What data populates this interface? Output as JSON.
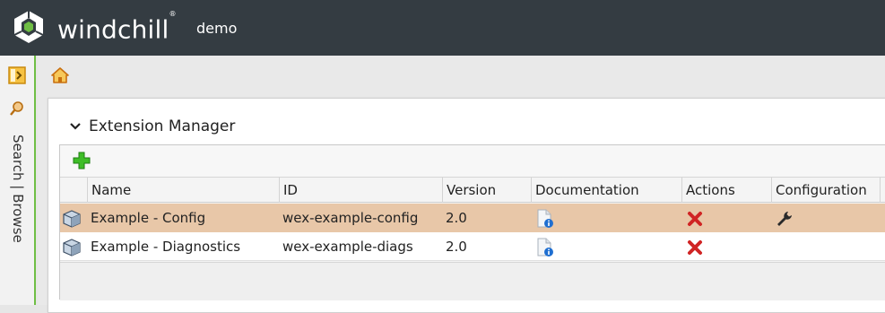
{
  "header": {
    "brand": "windchill",
    "trademark": "®",
    "context": "demo"
  },
  "sidebar": {
    "vertical_label": "Search | Browse"
  },
  "panel": {
    "title": "Extension Manager"
  },
  "table": {
    "columns": [
      "Name",
      "ID",
      "Version",
      "Documentation",
      "Actions",
      "Configuration"
    ],
    "rows": [
      {
        "name": "Example - Config",
        "id": "wex-example-config",
        "version": "2.0",
        "has_config": true,
        "selected": true
      },
      {
        "name": "Example - Diagnostics",
        "id": "wex-example-diags",
        "version": "2.0",
        "has_config": false,
        "selected": false
      }
    ]
  },
  "colors": {
    "topbar": "#343c42",
    "accent_green": "#6fbe44",
    "selected_row": "#e8c7a8",
    "delete_red": "#d02424"
  },
  "icons": {
    "logo": "windchill-logo-icon",
    "sidebar_toggle": "sidebar-expand-icon",
    "search": "search-icon",
    "home": "home-icon",
    "collapse": "chevron-down-icon",
    "add": "add-plus-icon",
    "extension": "extension-cube-icon",
    "documentation": "document-info-icon",
    "delete": "delete-x-icon",
    "configure": "wrench-icon"
  }
}
